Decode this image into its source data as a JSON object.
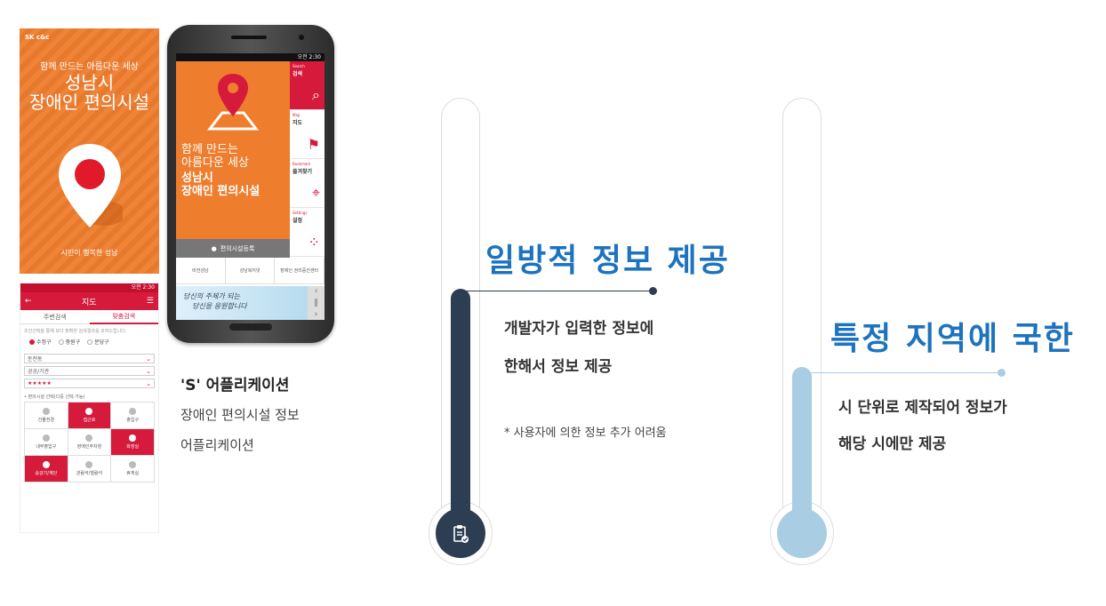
{
  "poster": {
    "logo": "SK c&c",
    "subtitle": "함께 만드는 아름다운 세상",
    "title_line1": "성남시",
    "title_line2": "장애인 편의시설",
    "slogan": "시민이 행복한 성남"
  },
  "map_app": {
    "status_time": "오전 2:30",
    "title": "지도",
    "back_icon": "back-arrow-icon",
    "menu_icon": "hamburger-icon",
    "tabs": [
      "주변검색",
      "맞춤검색"
    ],
    "active_tab": 1,
    "note": "조건선택을 통해 보다 정확한 검색결과를 보여드립니다.",
    "districts": [
      "수정구",
      "중원구",
      "분당구"
    ],
    "selected_district": 0,
    "selects": [
      "둔전동",
      "공공/기관",
      "★★★★★"
    ],
    "grid_label": "• 편의시설 선택(다중 선택 가능)",
    "grid": [
      {
        "label": "건물전경",
        "on": false
      },
      {
        "label": "접근로",
        "on": true
      },
      {
        "label": "출입구",
        "on": false
      },
      {
        "label": "내부출입구",
        "on": false
      },
      {
        "label": "장애인주차장",
        "on": false
      },
      {
        "label": "화장실",
        "on": true
      },
      {
        "label": "승강기/계단",
        "on": true
      },
      {
        "label": "관람석/열람석",
        "on": false
      },
      {
        "label": "휴게실",
        "on": false
      }
    ],
    "colors": {
      "accent": "#d61a3c"
    }
  },
  "phone": {
    "status_time": "오전 2:30",
    "hero_line1": "함께 만드는",
    "hero_line2": "아름다운 세상",
    "hero_line3": "성남시",
    "hero_line4": "장애인 편의시설",
    "menu": [
      {
        "en": "Search",
        "ko": "검색",
        "icon": "monitor-search-icon",
        "red": true
      },
      {
        "en": "Map",
        "ko": "지도",
        "icon": "map-flag-icon",
        "red": false
      },
      {
        "en": "Bookmark",
        "ko": "즐겨찾기",
        "icon": "mouse-icon",
        "red": false
      },
      {
        "en": "Settings",
        "ko": "설정",
        "icon": "dots-icon",
        "red": false
      }
    ],
    "register_label": "편의시설등록",
    "links": [
      "비전성남",
      "성남복지넷",
      "장애인 권리증진센터"
    ],
    "banner_line1": "당신의 주체가 되는",
    "banner_line2": "당신을 응원합니다"
  },
  "app_caption": {
    "title": "'S' 어플리케이션",
    "line1": "장애인 편의시설 정보",
    "line2": "어플리케이션"
  },
  "thermometer_left": {
    "heading": "일방적 정보 제공",
    "desc_line1": "개발자가 입력한 정보에",
    "desc_line2": "한해서 정보 제공",
    "note": "* 사용자에 의한 정보 추가 어려움",
    "mercury_color": "#2e3e52",
    "heading_color": "#1e73be"
  },
  "thermometer_right": {
    "heading": "특정 지역에 국한",
    "desc_line1": "시 단위로 제작되어 정보가",
    "desc_line2": "해당 시에만 제공",
    "mercury_color": "#a9cde2",
    "heading_color": "#1e73be"
  }
}
